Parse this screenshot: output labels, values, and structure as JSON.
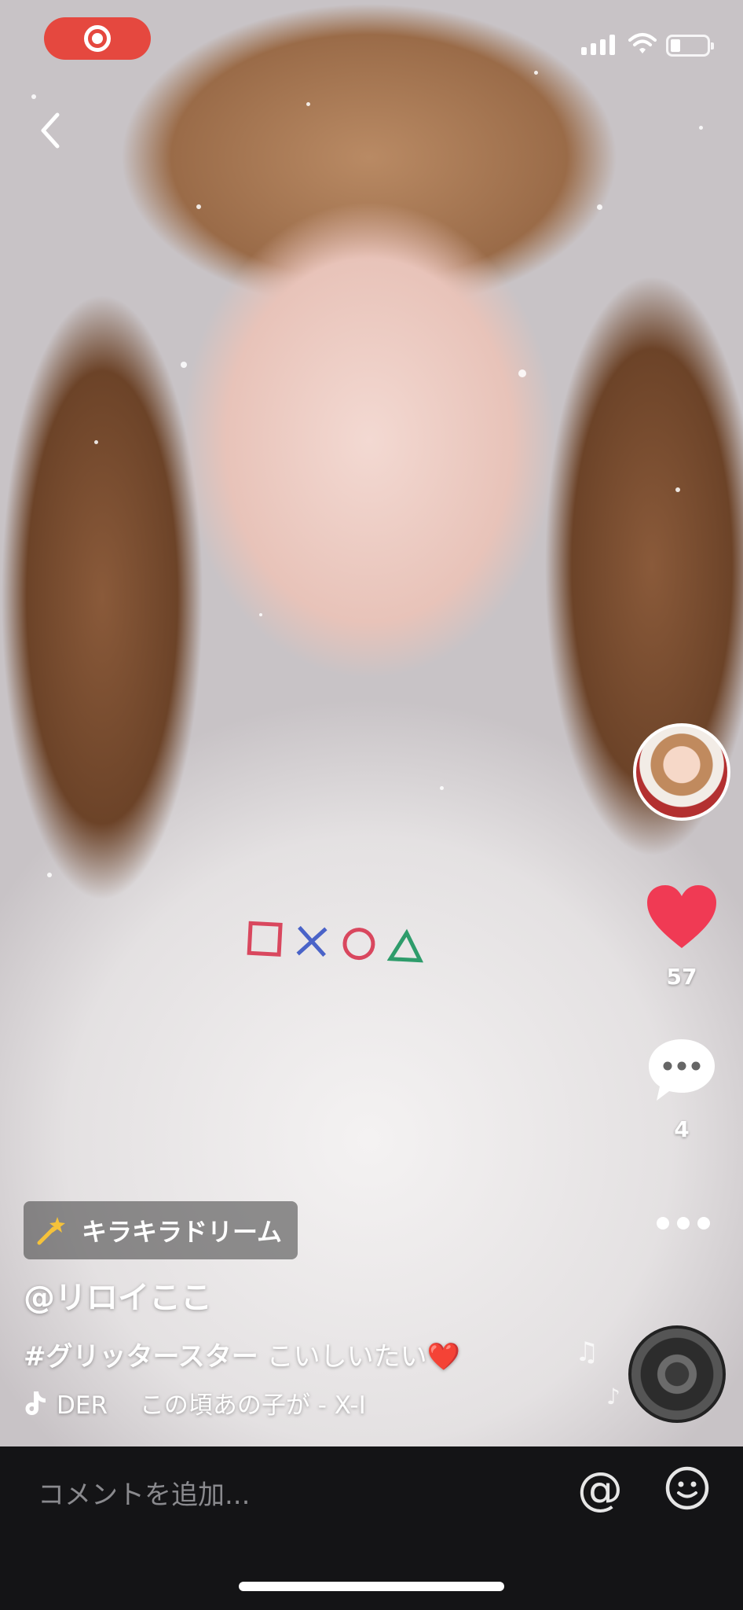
{
  "status_bar": {
    "recording_indicator": "record-icon",
    "signal": "signal-icon",
    "wifi": "wifi-icon",
    "battery": "battery-icon"
  },
  "navigation": {
    "back_icon": "chevron-left-icon"
  },
  "actions": {
    "like_icon": "heart-icon",
    "like_color": "#f03a54",
    "like_count": "57",
    "comment_icon": "speech-bubble-icon",
    "comment_count": "4",
    "more_icon": "more-horizontal-icon"
  },
  "video": {
    "effect_label": "キラキラドリーム",
    "effect_icon": "magic-wand-icon",
    "username": "@リロイここ",
    "caption_tag": "#グリッタースター",
    "caption_text": " こいしいたい",
    "caption_emoji": "❤️",
    "music_icon": "tiktok-note-icon",
    "music_title": "DER　 この頃あの子が - X-I"
  },
  "comment_bar": {
    "placeholder": "コメントを追加...",
    "mention_label": "@",
    "emoji_icon": "smiley-icon"
  }
}
